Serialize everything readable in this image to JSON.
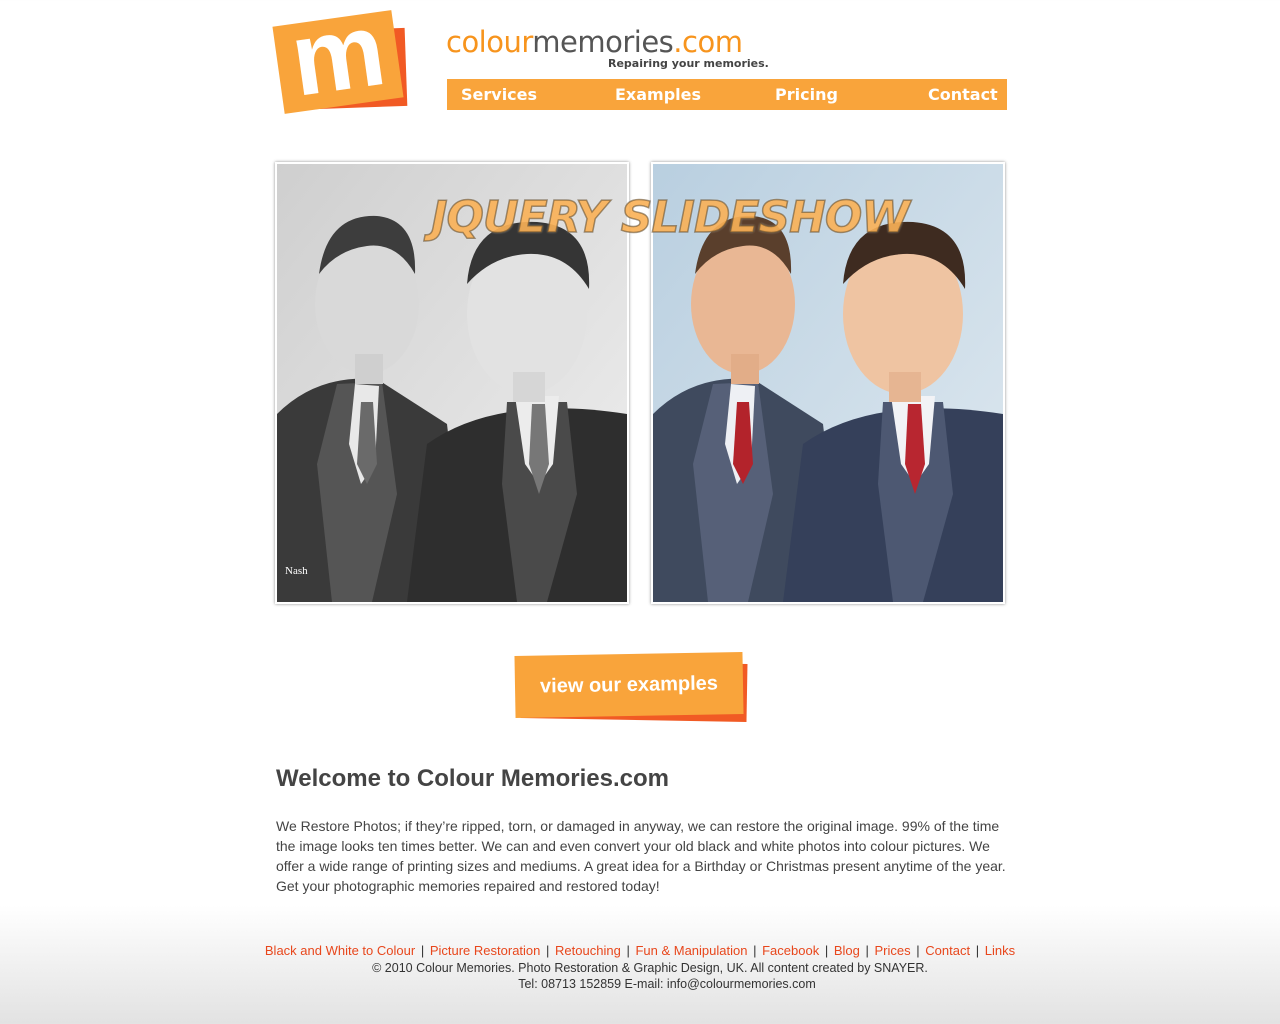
{
  "logo": {
    "letter": "m"
  },
  "brand": {
    "part1": "colour",
    "part2": "memories",
    "part3": ".com",
    "tagline": "Repairing your memories."
  },
  "nav": {
    "items": [
      {
        "label": "Services"
      },
      {
        "label": "Examples"
      },
      {
        "label": "Pricing"
      },
      {
        "label": "Contact"
      }
    ]
  },
  "slideshow": {
    "label": "JQUERY SLIDESHOW",
    "left_signature": "Nash"
  },
  "cta": {
    "label": "view our examples"
  },
  "welcome": {
    "title": "Welcome to Colour Memories.com",
    "body": "We Restore Photos; if they’re ripped, torn, or damaged in anyway, we can restore the original image.  99% of the time the image looks ten times better. We can and even convert your old black and white photos into colour pictures. We offer a wide range of printing sizes and mediums. A great idea for a Birthday or Christmas present anytime of the year. Get your photographic memories repaired and restored today!"
  },
  "footer": {
    "links": [
      {
        "label": "Black and White to Colour"
      },
      {
        "label": "Picture Restoration"
      },
      {
        "label": "Retouching"
      },
      {
        "label": "Fun & Manipulation"
      },
      {
        "label": "Facebook"
      },
      {
        "label": "Blog"
      },
      {
        "label": "Prices"
      },
      {
        "label": "Contact"
      },
      {
        "label": "Links"
      }
    ],
    "separator": "|",
    "copyright": "© 2010 Colour Memories. Photo Restoration & Graphic Design, UK. All content created by SNAYER.",
    "contact": "Tel: 08713 152859  E-mail: info@colourmemories.com"
  },
  "colors": {
    "accent_orange": "#f9a43b",
    "accent_red": "#f15a24",
    "link": "#e8471c",
    "text": "#444444"
  }
}
